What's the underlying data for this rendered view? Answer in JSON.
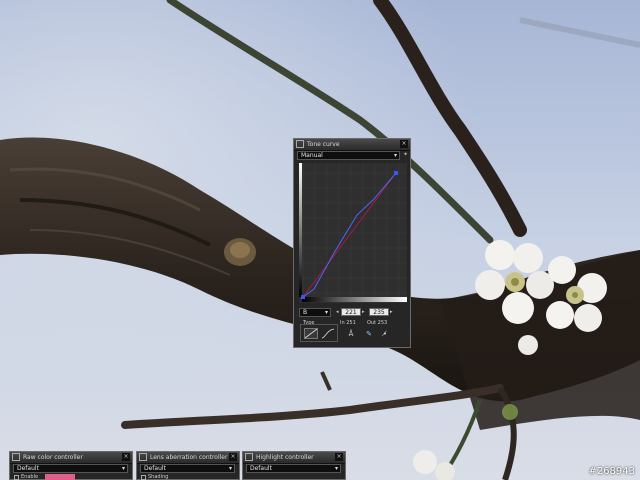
{
  "tone_curve": {
    "title": "Tone curve",
    "preset": "Manual",
    "channel": "B",
    "input_value": "221",
    "output_value": "235",
    "in_readout": "In 251",
    "out_readout": "Out 253",
    "type_label": "Type",
    "curve_color": "#3b55ff",
    "diagonal_color": "#c0144a"
  },
  "bottom_panels": [
    {
      "title": "Raw color controller",
      "preset": "Default",
      "option": "Enable"
    },
    {
      "title": "Lens aberration controller",
      "preset": "Default",
      "option": "Shading"
    },
    {
      "title": "Highlight controller",
      "preset": "Default"
    }
  ],
  "watermark": "#268943",
  "icons": {
    "panel_icon": "curve-icon",
    "close": "close-icon",
    "pin": "pin-icon",
    "auto": "auto-icon",
    "eyedropper": "eyedropper-icon",
    "point": "add-point-icon"
  }
}
